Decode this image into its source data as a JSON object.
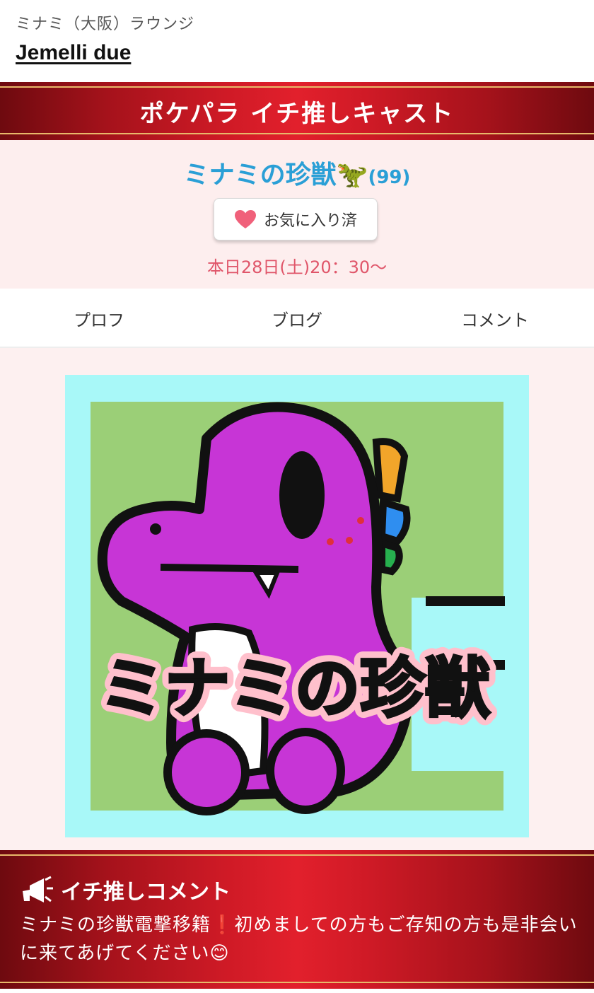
{
  "header": {
    "area": "ミナミ（大阪）ラウンジ",
    "shop_name": "Jemelli due"
  },
  "banner": {
    "title": "ポケパラ イチ推しキャスト"
  },
  "cast": {
    "name": "ミナミの珍獣🦖",
    "age": "(99)",
    "favorite_label": "お気に入り済",
    "schedule": "本日28日(土)20：30〜"
  },
  "tabs": [
    {
      "label": "プロフ"
    },
    {
      "label": "ブログ"
    },
    {
      "label": "コメント"
    }
  ],
  "photo": {
    "logo_text": "ミナミの珍獣"
  },
  "comment": {
    "heading": "イチ推しコメント",
    "text": "ミナミの珍獣電撃移籍❗️初めましての方もご存知の方も是非会いに来てあげてください😊"
  },
  "colors": {
    "banner_red": "#cf1a26",
    "cast_name": "#2a9fd6",
    "schedule": "#e0566a",
    "heart": "#f0607a",
    "tab_indicator": "#b06a6a"
  }
}
